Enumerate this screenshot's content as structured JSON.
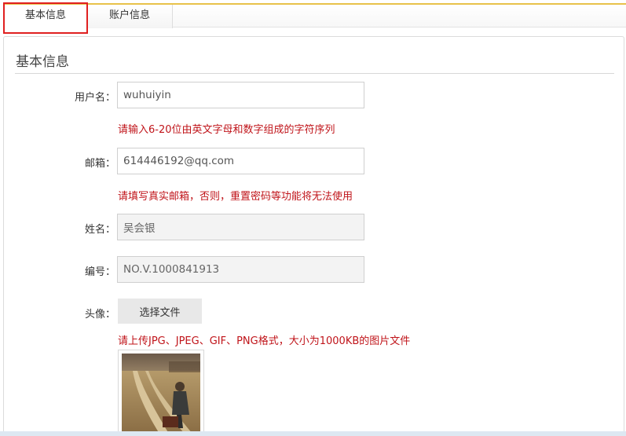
{
  "tabs": [
    {
      "label": "基本信息"
    },
    {
      "label": "账户信息"
    }
  ],
  "section": {
    "title": "基本信息"
  },
  "form": {
    "username": {
      "label": "用户名：",
      "value": "wuhuiyin",
      "hint": "请输入6-20位由英文字母和数字组成的字符序列"
    },
    "email": {
      "label": "邮箱：",
      "value": "614446192@qq.com",
      "hint": "请填写真实邮箱，否则，重置密码等功能将无法使用"
    },
    "name": {
      "label": "姓名：",
      "value": "吴会银"
    },
    "number": {
      "label": "编号：",
      "value": "NO.V.1000841913"
    },
    "avatar": {
      "label": "头像：",
      "button_label": "选择文件",
      "hint": "请上传JPG、JPEG、GIF、PNG格式，大小为1000KB的图片文件"
    }
  },
  "colors": {
    "accent_top": "#e8c24a",
    "hint": "#c0141a",
    "highlight": "#e02020"
  }
}
